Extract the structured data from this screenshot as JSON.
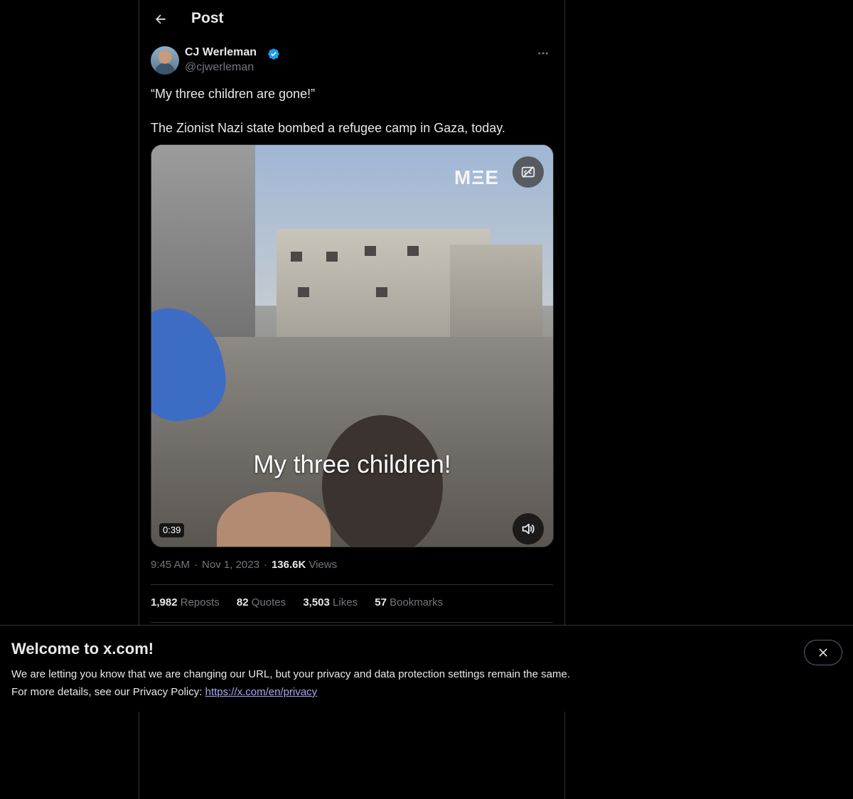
{
  "header": {
    "title": "Post"
  },
  "author": {
    "name": "CJ Werleman",
    "handle": "@cjwerleman",
    "verified": true
  },
  "tweet": {
    "paragraphs": [
      "“My three children are gone!”",
      "The Zionist Nazi state bombed a refugee camp in Gaza, today."
    ]
  },
  "video": {
    "logo_text": "MΞE",
    "subtitle": "My three children!",
    "duration": "0:39"
  },
  "meta": {
    "time": "9:45 AM",
    "date": "Nov 1, 2023",
    "views_count": "136.6K",
    "views_label": "Views"
  },
  "stats": [
    {
      "count": "1,982",
      "label": "Reposts"
    },
    {
      "count": "82",
      "label": "Quotes"
    },
    {
      "count": "3,503",
      "label": "Likes"
    },
    {
      "count": "57",
      "label": "Bookmarks"
    }
  ],
  "banner": {
    "title": "Welcome to x.com!",
    "line1": "We are letting you know that we are changing our URL, but your privacy and data protection settings remain the same.",
    "line2_prefix": "For more details, see our Privacy Policy:",
    "link_text": "https://x.com/en/privacy"
  },
  "colors": {
    "background": "#000000",
    "text": "#e7e9ea",
    "secondary": "#71767b",
    "verified": "#1d9bf0",
    "border": "#2f3336",
    "link": "#a9a6f2"
  },
  "icons": [
    "back-arrow-icon",
    "verified-badge-icon",
    "more-icon",
    "captions-icon",
    "volume-icon",
    "close-icon"
  ]
}
